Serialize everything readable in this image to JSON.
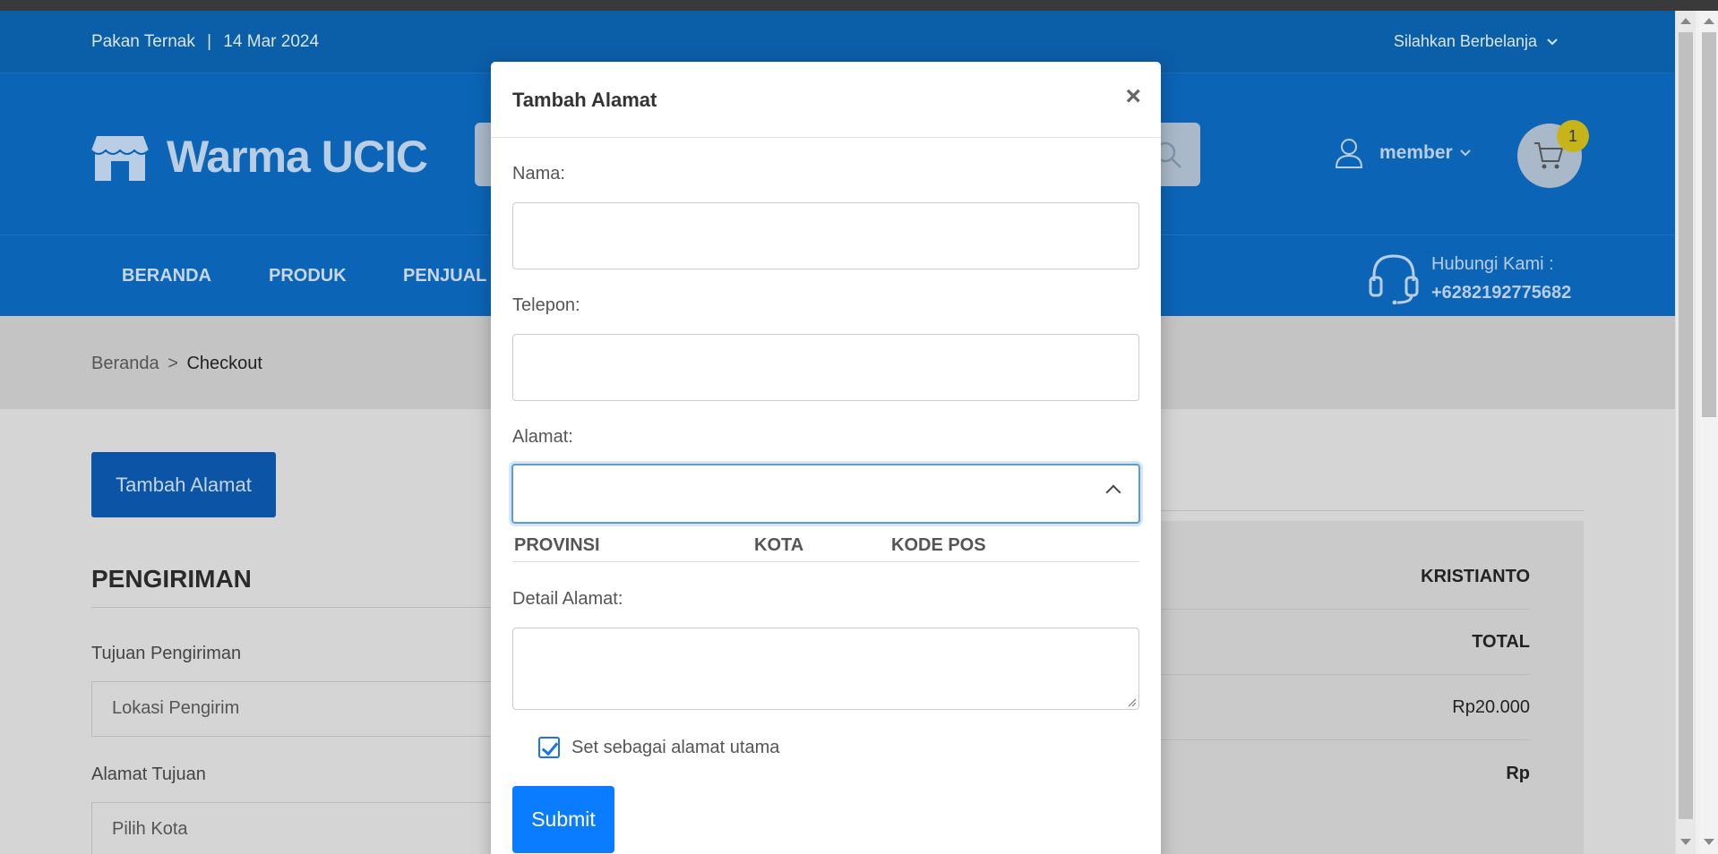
{
  "topbar": {
    "site": "Pakan Ternak",
    "separator": "|",
    "date": "14 Mar 2024",
    "greeting": "Silahkan Berbelanja"
  },
  "header": {
    "logo_text": "Warma UCIC",
    "user_label": "member",
    "cart_count": "1"
  },
  "nav": {
    "items": [
      {
        "label": "BERANDA"
      },
      {
        "label": "PRODUK"
      },
      {
        "label": "PENJUAL"
      }
    ],
    "contact_title": "Hubungi Kami :",
    "contact_phone": "+6282192775682"
  },
  "breadcrumb": {
    "home": "Beranda",
    "separator": ">",
    "current": "Checkout"
  },
  "content": {
    "tambah_button": "Tambah Alamat",
    "section_title": "PENGIRIMAN",
    "tujuan_label": "Tujuan Pengiriman",
    "tujuan_value": "Lokasi Pengirim",
    "alamat_tujuan_label": "Alamat Tujuan",
    "alamat_tujuan_value": "Pilih Kota"
  },
  "summary": {
    "name": "KRISTIANTO",
    "total_label": "TOTAL",
    "subtotal": "Rp20.000",
    "grand": "Rp"
  },
  "modal": {
    "title": "Tambah Alamat",
    "close": "×",
    "nama_label": "Nama:",
    "telepon_label": "Telepon:",
    "alamat_label": "Alamat:",
    "dropdown_headers": [
      "PROVINSI",
      "KOTA",
      "KODE POS"
    ],
    "detail_label": "Detail Alamat:",
    "checkbox_label": "Set sebagai alamat utama",
    "checkbox_checked": true,
    "submit_label": "Submit"
  },
  "colors": {
    "header_blue": "#0b64b6",
    "primary_button": "#0a7cff",
    "cart_badge": "#c7b419"
  }
}
